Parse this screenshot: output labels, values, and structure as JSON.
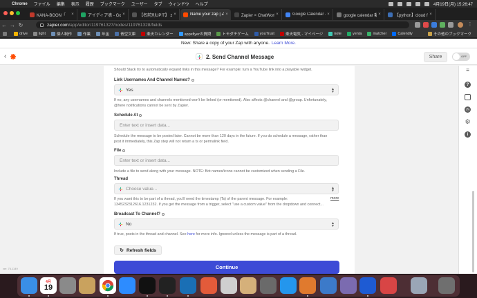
{
  "menubar": {
    "app": "Chrome",
    "items": [
      "ファイル",
      "編集",
      "表示",
      "履歴",
      "ブックマーク",
      "ユーザー",
      "タブ",
      "ウィンドウ",
      "ヘルプ"
    ],
    "clock": "4月19日(月) 15:26:47"
  },
  "tabs": [
    {
      "title": "KANA-BOON「",
      "color": "#c0392b"
    },
    {
      "title": "アイディア表 - Google",
      "color": "#1fa463"
    },
    {
      "title": "【名前別UP!T】 zapie",
      "color": "#555555"
    },
    {
      "title": "Name your zap | Zapie",
      "color": "#ff4a00",
      "active": true
    },
    {
      "title": "Zapier × ChatWork で",
      "color": "#444444"
    },
    {
      "title": "Google Calendar - Wo",
      "color": "#4285f4"
    },
    {
      "title": "google calendar 動画",
      "color": "#777777"
    },
    {
      "title": "【python】cloud func",
      "color": "#3d6fb5"
    }
  ],
  "address": {
    "host": "zapier.com",
    "path": "/app/editor/119761327/nodes/119761328/fields"
  },
  "bookmarks": [
    {
      "label": "drive",
      "color": "#f4b400"
    },
    {
      "label": "light",
      "color": "#888888"
    },
    {
      "label": "個人制作",
      "color": "#6e8fb5"
    },
    {
      "label": "作業",
      "color": "#6e8fb5"
    },
    {
      "label": "年金",
      "color": "#6e8fb5"
    },
    {
      "label": "青空文庫",
      "color": "#4a6fa5"
    },
    {
      "label": "楽天カレンダー",
      "color": "#bf0000"
    },
    {
      "label": "appsflyerの質問",
      "color": "#3399ff"
    },
    {
      "label": "トモダチゲーム",
      "color": "#5a9a4a"
    },
    {
      "label": "youTrust",
      "color": "#2e5ba8"
    },
    {
      "label": "楽天電気 - マイページ",
      "color": "#bf0000"
    },
    {
      "label": "note",
      "color": "#41c9b4"
    },
    {
      "label": "yenta",
      "color": "#22aa66"
    },
    {
      "label": "matcher",
      "color": "#3ab26a"
    },
    {
      "label": "Calendly",
      "color": "#006bff"
    }
  ],
  "bookmarks_other": "その他のブックマーク",
  "banner": {
    "text": "New: Share a copy of your Zap with anyone.",
    "link": "Learn More."
  },
  "header": {
    "step_title": "2. Send Channel Message",
    "share_label": "Share",
    "toggle_label": "OFF"
  },
  "form": {
    "unfurl_help": "Should Slack try to automatically expand links in this message? For example: turn a YouTube link into a playable widget.",
    "link_names": {
      "label": "Link Usernames And Channel Names?",
      "value": "Yes",
      "help": "If no, any usernames and channels mentioned won't be linked (or mentioned). Also affects @channel and @group. Unfortunately, @here notifications cannot be sent by Zapier."
    },
    "schedule_at": {
      "label": "Schedule At",
      "placeholder": "Enter text or insert data...",
      "help": "Schedule the message to be posted later. Cannot be more than 120 days in the future. If you do schedule a message, rather than post it immediately, this Zap step will not return a ts or permalink field."
    },
    "file": {
      "label": "File",
      "placeholder": "Enter text or insert data...",
      "help": "Include a file to send along with your message. NOTE: Bot names/icons cannot be customized when sending a File."
    },
    "thread": {
      "label": "Thread",
      "placeholder": "Choose value...",
      "help": "If you want this to be part of a thread, you'll need the timestamp (Ts) of the parent message. For example: 1345232312616.1231232. If you get the message from a trigger, select \"use a custom value\" from the dropdown and connect...",
      "more": "more"
    },
    "broadcast": {
      "label": "Broadcast To Channel?",
      "value": "No",
      "help_before": "If true, posts in the thread and channel. See",
      "help_link": "here",
      "help_after": "for more info. Ignored unless the message is part of a thread."
    },
    "refresh_label": "Refresh fields",
    "continue_label": "Continue"
  },
  "version": "ver. 76.1149",
  "dock": {
    "calendar_month": "4月",
    "calendar_day": "19"
  }
}
